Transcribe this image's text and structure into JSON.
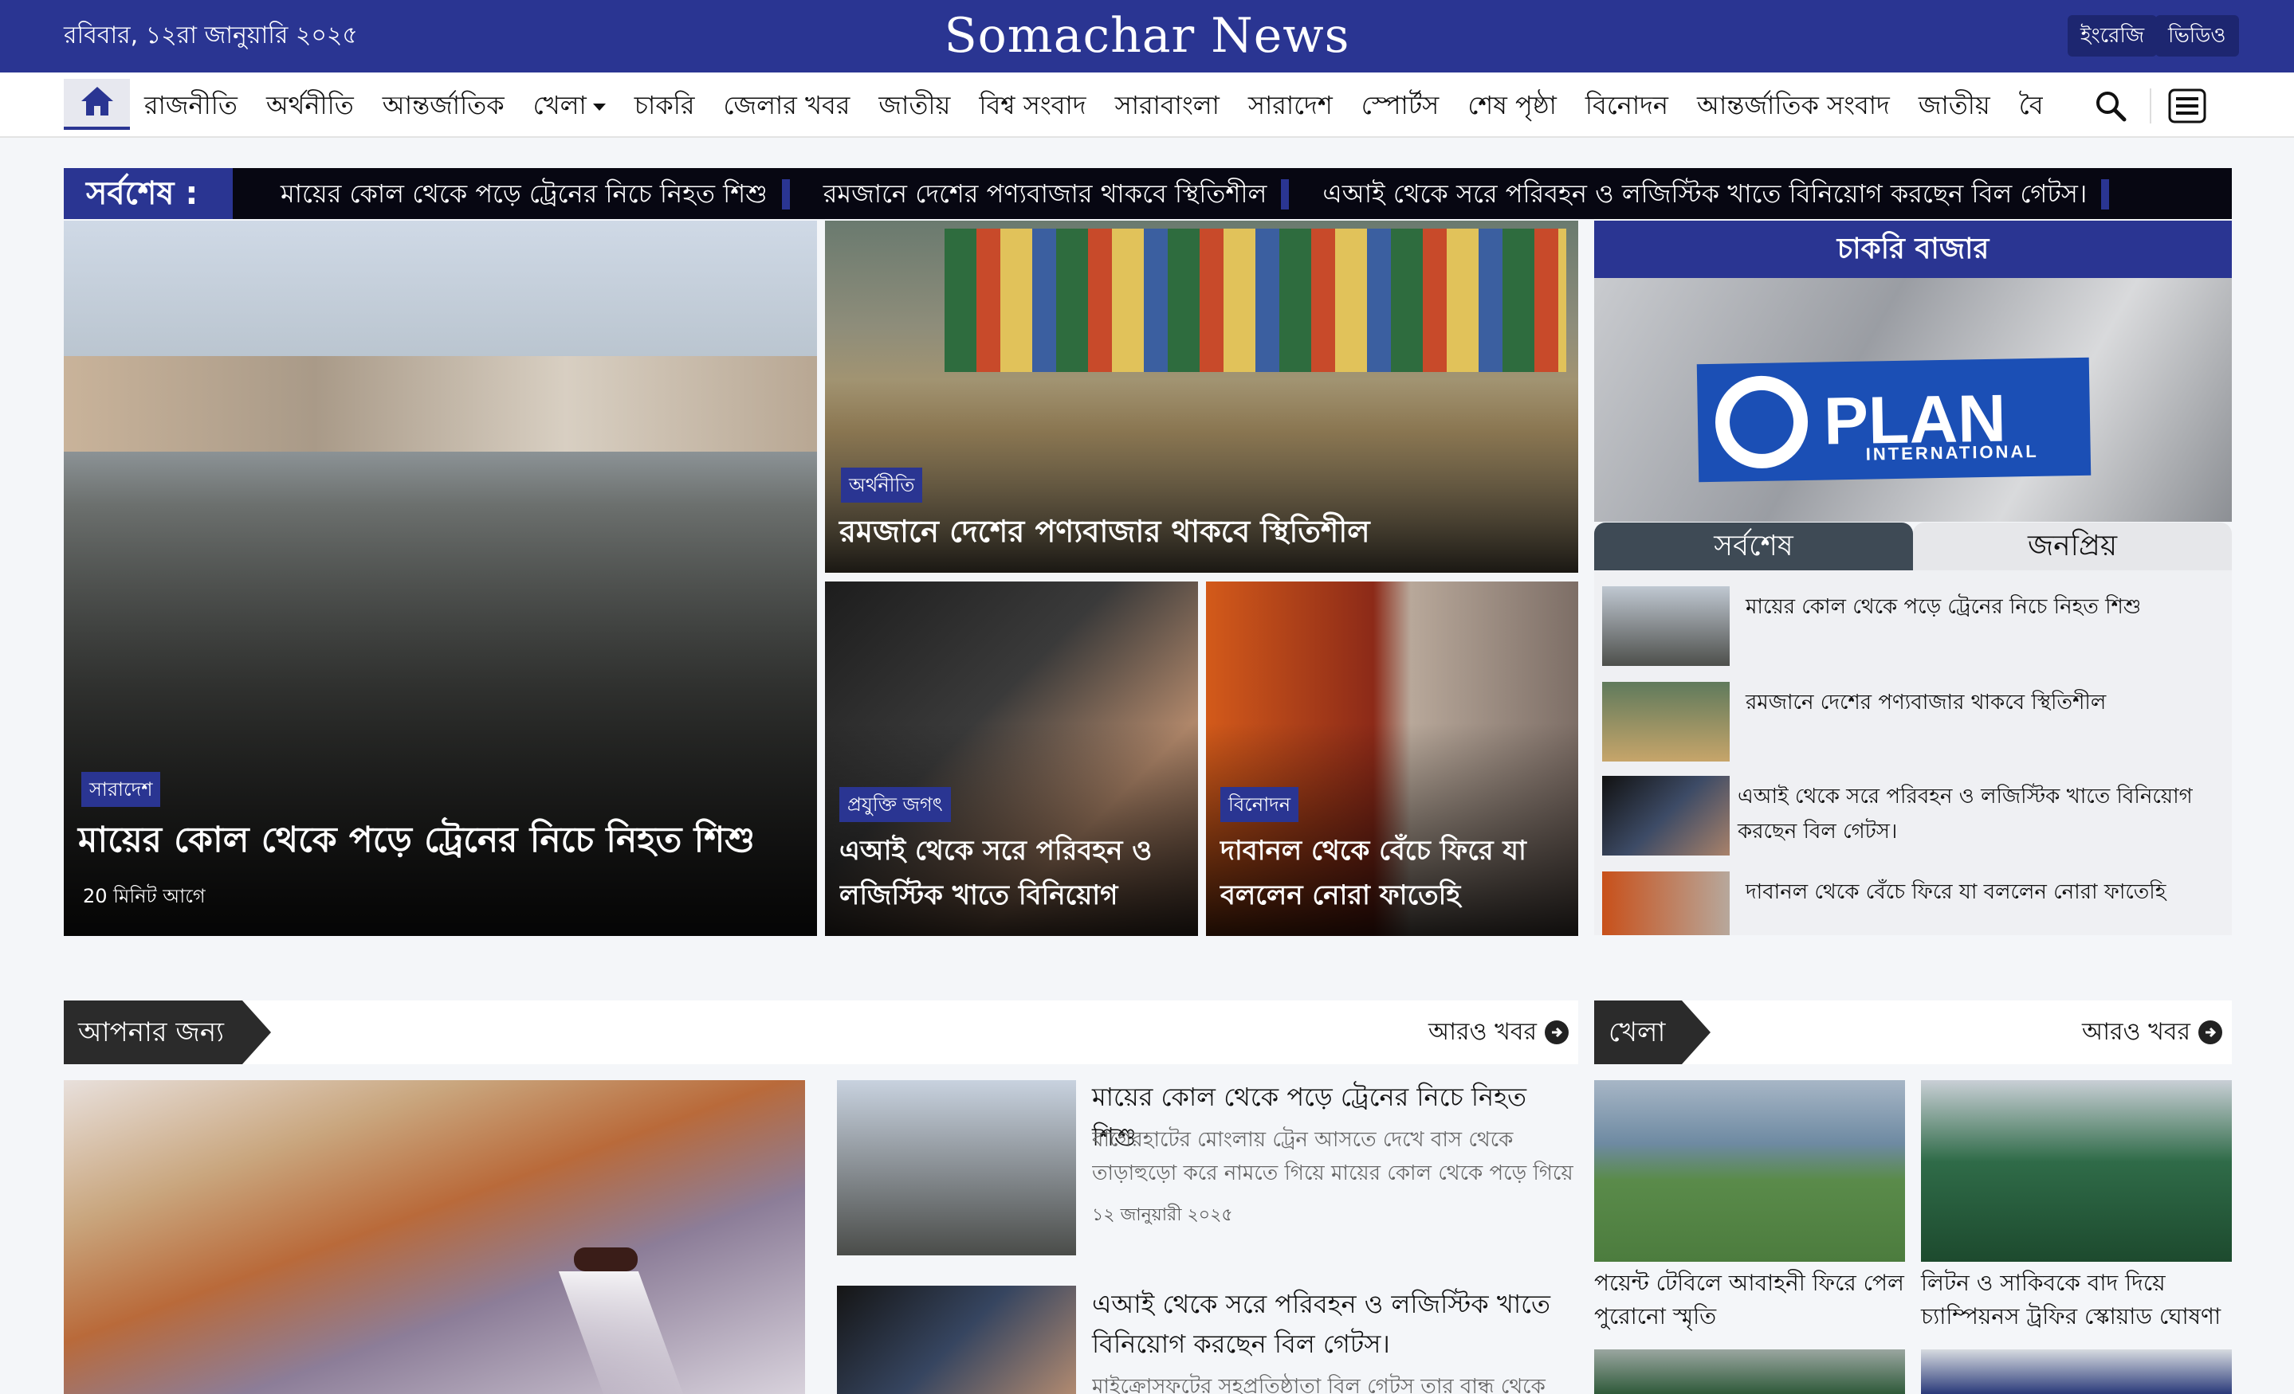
{
  "topbar": {
    "date": "রবিবার, ১২রা জানুয়ারি ২০২৫",
    "brand": "Somachar News",
    "btn_english": "ইংরেজি",
    "btn_video": "ভিডিও"
  },
  "nav": {
    "items": [
      "রাজনীতি",
      "অর্থনীতি",
      "আন্তর্জাতিক",
      "খেলা",
      "চাকরি",
      "জেলার খবর",
      "জাতীয়",
      "বিশ্ব সংবাদ",
      "সারাবাংলা",
      "সারাদেশ",
      "স্পোর্টস",
      "শেষ পৃষ্ঠা",
      "বিনোদন",
      "আন্তর্জাতিক সংবাদ",
      "জাতীয়",
      "বৈ"
    ],
    "icons": [
      "home-icon",
      "search-icon",
      "menu-icon",
      "chevron-down-icon"
    ]
  },
  "ticker": {
    "label": "সর্বশেষ :",
    "items": [
      "মায়ের কোল থেকে পড়ে ট্রেনের নিচে নিহত শিশু",
      "রমজানে দেশের পণ্যবাজার থাকবে স্থিতিশীল",
      "এআই থেকে সরে পরিবহন ও লজিস্টিক খাতে বিনিয়োগ করছেন বিল গেটস।"
    ]
  },
  "hero": {
    "main": {
      "category": "সারাদেশ",
      "title": "মায়ের কোল থেকে পড়ে ট্রেনের নিচে নিহত শিশু",
      "time": "20 মিনিট আগে"
    },
    "top": {
      "category": "অর্থনীতি",
      "title": "রমজানে দেশের পণ্যবাজার থাকবে স্থিতিশীল"
    },
    "bottom_left": {
      "category": "প্রযুক্তি জগৎ",
      "title": "এআই থেকে সরে পরিবহন ও লজিস্টিক খাতে বিনিয়োগ করছে..."
    },
    "bottom_right": {
      "category": "বিনোদন",
      "title": "দাবানল থেকে বেঁচে ফিরে যা বললেন নোরা ফাতেহি"
    }
  },
  "sidebar": {
    "jobs_title": "চাকরি বাজার",
    "ad": {
      "brand": "PLAN",
      "sub": "INTERNATIONAL"
    },
    "tabs": [
      "সর্বশেষ",
      "জনপ্রিয়"
    ],
    "items": [
      "মায়ের কোল থেকে পড়ে ট্রেনের নিচে নিহত শিশু",
      "রমজানে দেশের পণ্যবাজার থাকবে স্থিতিশীল",
      "এআই থেকে সরে পরিবহন ও লজিস্টিক খাতে বিনিয়োগ করছেন বিল গেটস।",
      "দাবানল থেকে বেঁচে ফিরে যা বললেন নোরা ফাতেহি"
    ]
  },
  "for_you": {
    "title": "আপনার জন্য",
    "more": "আরও খবর",
    "articles": [
      {
        "title": "মায়ের কোল থেকে পড়ে ট্রেনের নিচে নিহত শিশু",
        "excerpt": "বাগেরহাটের মোংলায় ট্রেন আসতে দেখে বাস থেকে তাড়াহুড়ো করে নামতে গিয়ে মায়ের কোল থেকে পড়ে গিয়ে একটি চল...",
        "date": "১২ জানুয়ারী ২০২৫"
      },
      {
        "title": "এআই থেকে সরে পরিবহন ও লজিস্টিক খাতে বিনিয়োগ করছেন বিল গেটস।",
        "excerpt": "মাইক্রোসফটের সহপ্রতিষ্ঠাতা বিল গেটস তার বান্ধ থেকে"
      }
    ]
  },
  "sports": {
    "title": "খেলা",
    "more": "আরও খবর",
    "items": [
      "পয়েন্ট টেবিলে আবাহনী ফিরে পেল পুরোনো স্মৃতি",
      "লিটন ও সাকিবকে বাদ দিয়ে চ্যাম্পিয়নস ট্রফির স্কোয়াড ঘোষণা"
    ]
  }
}
